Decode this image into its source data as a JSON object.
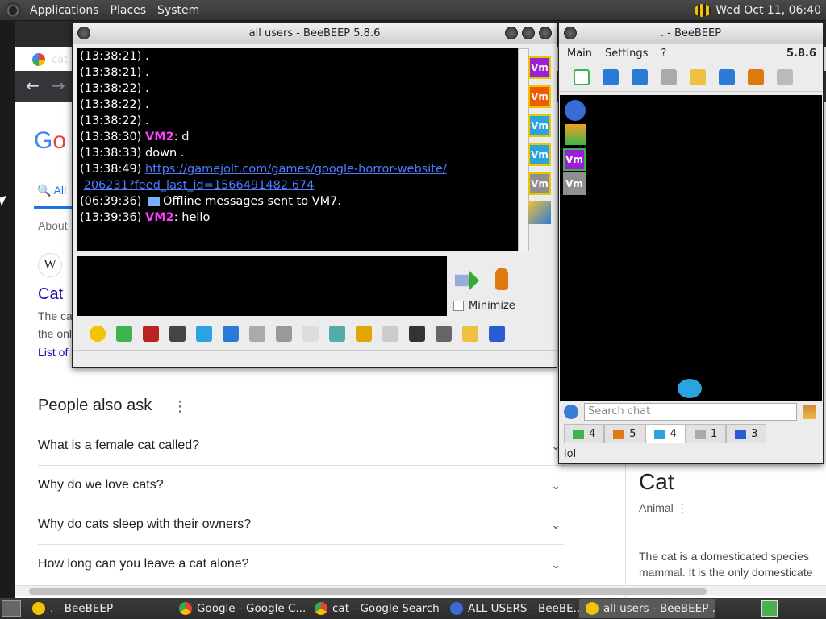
{
  "top_panel": {
    "menus": [
      "Applications",
      "Places",
      "System"
    ],
    "clock": "Wed Oct 11, 06:40"
  },
  "chrome": {
    "tab_title": "cat",
    "search": {
      "logo_letters": [
        "G",
        "o"
      ],
      "all_tab": "All",
      "about": "About",
      "result_title": "Cat",
      "result_snip1": "The ca",
      "result_snip2": "the onl",
      "result_link": "List of",
      "paa_title": "People also ask",
      "paa_items": [
        "What is a female cat called?",
        "Why do we love cats?",
        "Why do cats sleep with their owners?",
        "How long can you leave a cat alone?"
      ],
      "kp_title": "Cat",
      "kp_sub": "Animal",
      "kp_text1": "The cat is a domesticated species",
      "kp_text2": "mammal. It is the only domesticate"
    }
  },
  "chat_window": {
    "title": "all users - BeeBEEP 5.8.6",
    "messages": [
      {
        "ts": "(13:38:21)",
        "who": "",
        "text": ".",
        "link": ""
      },
      {
        "ts": "(13:38:21)",
        "who": "",
        "text": ".",
        "link": ""
      },
      {
        "ts": "(13:38:22)",
        "who": "",
        "text": ".",
        "link": ""
      },
      {
        "ts": "(13:38:22)",
        "who": "",
        "text": ".",
        "link": ""
      },
      {
        "ts": "(13:38:22)",
        "who": "",
        "text": ".",
        "link": ""
      },
      {
        "ts": "(13:38:30)",
        "who": "VM2",
        "text": ": d",
        "link": ""
      },
      {
        "ts": "(13:38:33)",
        "who": "",
        "text": "down .",
        "link": ""
      },
      {
        "ts": "(13:38:49)",
        "who": "",
        "text": "",
        "link": "https://gamejolt.com/games/google-horror-website/"
      },
      {
        "ts": "",
        "who": "",
        "text": "",
        "link": "206231?feed_last_id=1566491482.674"
      },
      {
        "ts": "(06:39:36)",
        "who": "",
        "text": "Offline messages sent to VM7.",
        "link": "",
        "mail": true
      },
      {
        "ts": "(13:39:36)",
        "who": "VM2",
        "text": ": hello",
        "link": ""
      }
    ],
    "minimize_label": "Minimize",
    "side_users": [
      {
        "label": "Vm",
        "color": "#9b1fd6"
      },
      {
        "label": "Vm",
        "color": "#f15a00"
      },
      {
        "label": "Vm",
        "color": "#2aa3e0"
      },
      {
        "label": "Vm",
        "color": "#2aa3e0"
      },
      {
        "label": "Vm",
        "color": "#8f8f8f"
      }
    ],
    "toolbar_icons": [
      {
        "name": "emoticon-icon",
        "color": "#f3c200"
      },
      {
        "name": "highlight-icon",
        "color": "#3cb44b"
      },
      {
        "name": "font-icon",
        "color": "#b22"
      },
      {
        "name": "color-picker-icon",
        "color": "#444"
      },
      {
        "name": "filter-icon",
        "color": "#2aa3e0"
      },
      {
        "name": "settings-gear-icon",
        "color": "#2a7bd5"
      },
      {
        "name": "spellcheck-icon",
        "color": "#aaa"
      },
      {
        "name": "dictionary-icon",
        "color": "#999"
      },
      {
        "name": "sound-icon",
        "color": "#ddd"
      },
      {
        "name": "send-file-icon",
        "color": "#5aa"
      },
      {
        "name": "folder-share-icon",
        "color": "#e0a800"
      },
      {
        "name": "html-code-icon",
        "color": "#ccc"
      },
      {
        "name": "screenshot-icon",
        "color": "#333"
      },
      {
        "name": "window-icon",
        "color": "#666"
      },
      {
        "name": "note-edit-icon",
        "color": "#f0c040"
      },
      {
        "name": "save-icon",
        "color": "#2a5bd5"
      }
    ]
  },
  "main_window": {
    "title": ". - BeeBEEP",
    "menus": [
      "Main",
      "Settings",
      "?"
    ],
    "version": "5.8.6",
    "toolbar_icons": [
      {
        "name": "status-selector-icon",
        "color": "#3cb44b"
      },
      {
        "name": "edit-profile-icon",
        "color": "#2a7bd5"
      },
      {
        "name": "network-icon",
        "color": "#2a7bd5"
      },
      {
        "name": "groups-icon",
        "color": "#aaa"
      },
      {
        "name": "pen-icon",
        "color": "#f0c040"
      },
      {
        "name": "tools-icon",
        "color": "#2a7bd5"
      },
      {
        "name": "update-icon",
        "color": "#e07a10"
      },
      {
        "name": "trash-icon",
        "color": "#bbb"
      }
    ],
    "panel_users": [
      {
        "label": "Vm",
        "color": "#9b1fd6"
      },
      {
        "label": "Vm",
        "color": "#8f8f8f"
      }
    ],
    "search_placeholder": "Search chat",
    "tabs": [
      {
        "name": "tab-users",
        "count": "4",
        "color": "#3cb44b"
      },
      {
        "name": "tab-groups",
        "count": "5",
        "color": "#e07a10"
      },
      {
        "name": "tab-chats",
        "count": "4",
        "color": "#2aa3e0",
        "active": true
      },
      {
        "name": "tab-shares",
        "count": "1",
        "color": "#aaa"
      },
      {
        "name": "tab-log",
        "count": "3",
        "color": "#2a5bd5"
      }
    ],
    "status_text": "lol"
  },
  "taskbar": {
    "tasks": [
      {
        "label": ". - BeeBEEP",
        "icon": "beebeep-icon"
      },
      {
        "label": "Google - Google C...",
        "icon": "chrome-icon"
      },
      {
        "label": "cat - Google Search ...",
        "icon": "chrome-icon"
      },
      {
        "label": "ALL USERS - BeeBE...",
        "icon": "beebeep-chat-icon"
      },
      {
        "label": "all users - BeeBEEP ...",
        "icon": "beebeep-icon",
        "active": true
      }
    ]
  }
}
